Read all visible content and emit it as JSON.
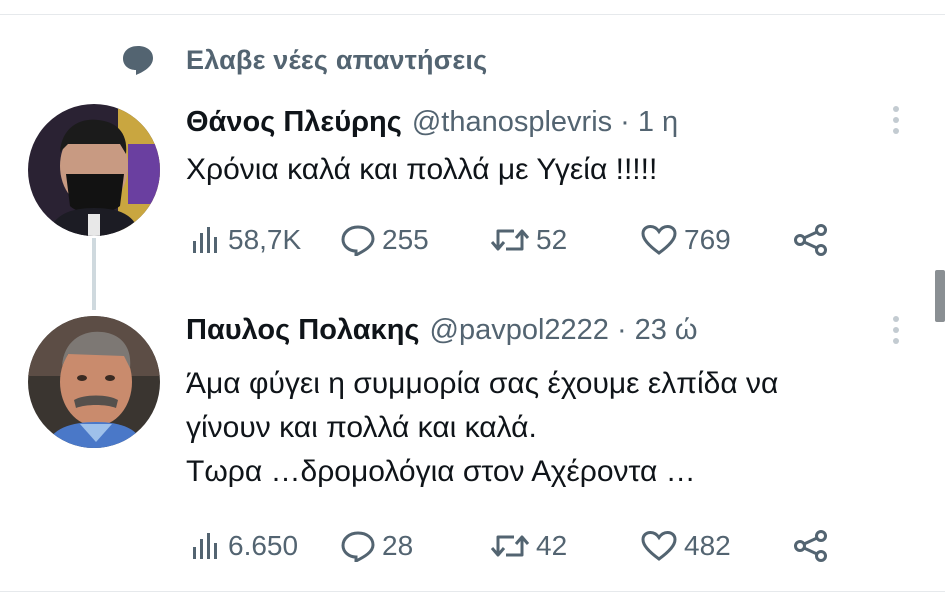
{
  "header": {
    "text": "Ελαβε νέες απαντήσεις",
    "icon": "speech-bubble-icon"
  },
  "tweets": [
    {
      "name": "Θάνος Πλεύρης",
      "handle": "@thanosplevris",
      "separator": "·",
      "time": "1 η",
      "lines": [
        "Χρόνια καλά και πολλά με Υγεία !!!!!"
      ],
      "views": "58,7K",
      "replies": "255",
      "retweets": "52",
      "likes": "769"
    },
    {
      "name": "Παυλος Πολακης",
      "handle": "@pavpol2222",
      "separator": "·",
      "time": "23 ώ",
      "lines": [
        "Άμα φύγει η συμμορία σας έχουμε ελπίδα να",
        "γίνουν και πολλά και καλά.",
        "Τωρα …δρομολόγια στον Αχέροντα …"
      ],
      "views": "6.650",
      "replies": "28",
      "retweets": "42",
      "likes": "482"
    }
  ],
  "colors": {
    "text": "#0f1419",
    "muted": "#536471",
    "divider": "#e6e9ec"
  }
}
